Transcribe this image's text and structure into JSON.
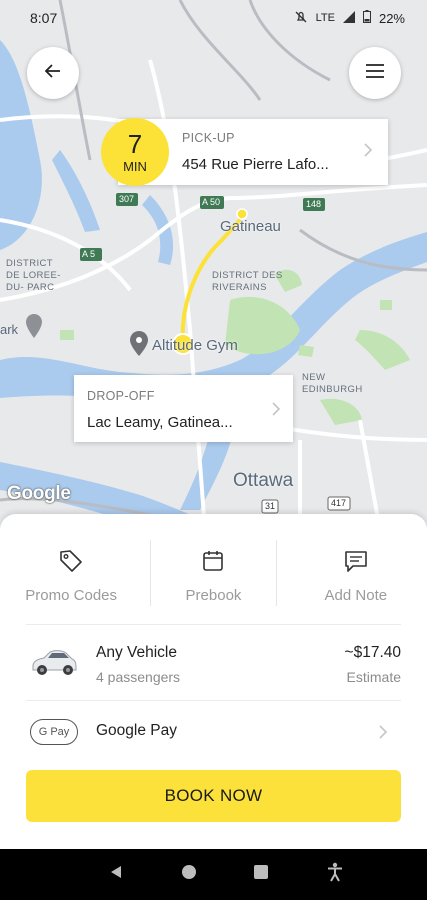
{
  "status_bar": {
    "time": "8:07",
    "network": "LTE",
    "battery": "22%"
  },
  "map": {
    "labels": {
      "gatineau": "Gatineau",
      "district_loree": "DISTRICT DE LOREE- DU- PARC",
      "district_riverains": "DISTRICT DES RIVERAINS",
      "park": "ark",
      "gym": "Altitude Gym",
      "new_edinburgh": "NEW EDINBURGH",
      "ottawa": "Ottawa",
      "a50": "A 50",
      "a5": "A 5",
      "r307": "307",
      "r148": "148",
      "r417": "417",
      "r31": "31"
    },
    "attribution": "Google"
  },
  "pickup": {
    "eta_value": "7",
    "eta_unit": "MIN",
    "label": "PICK-UP",
    "address": "454 Rue Pierre Lafo..."
  },
  "dropoff": {
    "label": "DROP-OFF",
    "address": "Lac Leamy, Gatinea..."
  },
  "actions": [
    {
      "label": "Promo Codes",
      "icon": "tag-icon"
    },
    {
      "label": "Prebook",
      "icon": "calendar-icon"
    },
    {
      "label": "Add Note",
      "icon": "note-icon"
    }
  ],
  "vehicle": {
    "name": "Any Vehicle",
    "passengers": "4 passengers",
    "price": "~$17.40",
    "price_note": "Estimate"
  },
  "payment": {
    "badge": "G Pay",
    "name": "Google Pay"
  },
  "book_button": {
    "label": "BOOK NOW"
  },
  "colors": {
    "accent": "#fce136",
    "water": "#aacaee",
    "park": "#c2e3b3"
  }
}
